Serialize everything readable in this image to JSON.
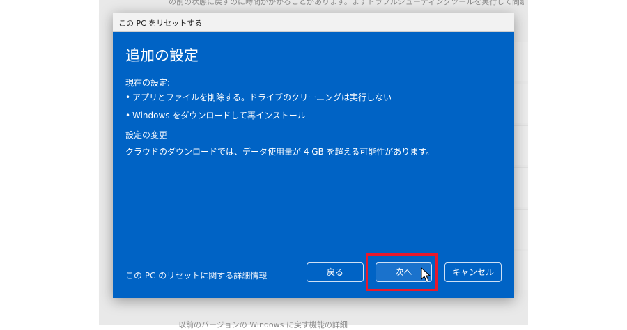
{
  "background": {
    "top_text": "の前の状態に戻すのに時間がかかることがあります。まずトラブルシューティングツールを実行して問題を解決してみてください",
    "bottom_text": "以前のバージョンの Windows に戻す機能の詳細"
  },
  "dialog": {
    "title": "この PC をリセットする",
    "heading": "追加の設定",
    "current_settings_label": "現在の設定:",
    "bullets": [
      "アプリとファイルを削除する。ドライブのクリーニングは実行しない",
      "Windows をダウンロードして再インストール"
    ],
    "bullet_char": "•",
    "change_settings_link": "設定の変更",
    "note": "クラウドのダウンロードでは、データ使用量が 4 GB を超える可能性があります。",
    "footer_link": "この PC のリセットに関する詳細情報",
    "buttons": {
      "back": "戻る",
      "next": "次へ",
      "cancel": "キャンセル"
    }
  },
  "colors": {
    "dialog_bg": "#0063c5",
    "highlight": "#e8192c"
  },
  "icons": {
    "cursor": "mouse-pointer-icon"
  }
}
